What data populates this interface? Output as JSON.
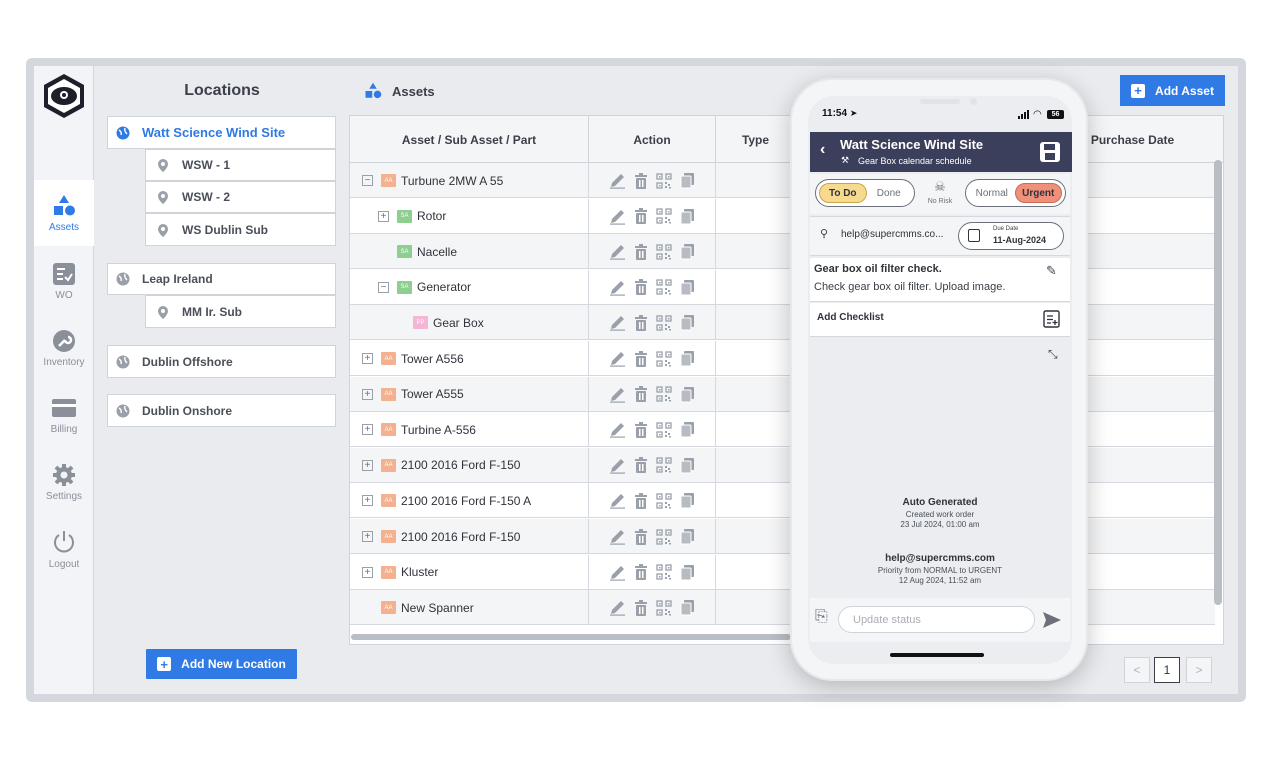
{
  "sidebar": {
    "items": [
      {
        "label": "Assets",
        "icon": "shapes-icon",
        "active": true
      },
      {
        "label": "WO",
        "icon": "checklist-icon"
      },
      {
        "label": "Inventory",
        "icon": "wrench-icon"
      },
      {
        "label": "Billing",
        "icon": "card-icon"
      },
      {
        "label": "Settings",
        "icon": "gear-icon"
      },
      {
        "label": "Logout",
        "icon": "power-icon"
      }
    ]
  },
  "locations": {
    "title": "Locations",
    "sites": [
      {
        "label": "Watt Science Wind Site",
        "selected": true,
        "subs": [
          "WSW - 1",
          "WSW - 2",
          "WS Dublin Sub"
        ]
      },
      {
        "label": "Leap Ireland",
        "subs": [
          "MM Ir. Sub"
        ]
      },
      {
        "label": "Dublin Offshore",
        "subs": []
      },
      {
        "label": "Dublin Onshore",
        "subs": []
      }
    ],
    "add_button": "Add New Location"
  },
  "assets": {
    "title": "Assets",
    "add_button": "Add Asset",
    "columns": [
      "Asset / Sub Asset / Part",
      "Action",
      "Type",
      "Purchase Date"
    ],
    "rows": [
      {
        "name": "Turbune 2MW A 55",
        "badge": "AA",
        "toggle": "−",
        "level": 0
      },
      {
        "name": "Rotor",
        "badge": "SA",
        "toggle": "+",
        "level": 1
      },
      {
        "name": "Nacelle",
        "badge": "SA",
        "toggle": "",
        "level": 1
      },
      {
        "name": "Generator",
        "badge": "SA",
        "toggle": "−",
        "level": 1
      },
      {
        "name": "Gear Box",
        "badge": "PP",
        "toggle": "",
        "level": 2
      },
      {
        "name": "Tower A556",
        "badge": "AA",
        "toggle": "+",
        "level": 0
      },
      {
        "name": "Tower A555",
        "badge": "AA",
        "toggle": "+",
        "level": 0
      },
      {
        "name": "Turbine A-556",
        "badge": "AA",
        "toggle": "+",
        "level": 0
      },
      {
        "name": "2100 2016 Ford F-150",
        "badge": "AA",
        "toggle": "+",
        "level": 0
      },
      {
        "name": "2100 2016 Ford F-150 A",
        "badge": "AA",
        "toggle": "+",
        "level": 0
      },
      {
        "name": "2100 2016 Ford F-150",
        "badge": "AA",
        "toggle": "+",
        "level": 0
      },
      {
        "name": "Kluster",
        "badge": "AA",
        "toggle": "+",
        "level": 0
      },
      {
        "name": "New Spanner",
        "badge": "AA",
        "toggle": "",
        "level": 0
      }
    ],
    "pagination": {
      "prev": "<",
      "current": "1",
      "next": ">"
    }
  },
  "phone": {
    "time": "11:54",
    "battery": "56",
    "header_title": "Watt Science Wind Site",
    "header_subtitle": "Gear Box calendar schedule",
    "status_todo": "To Do",
    "status_done": "Done",
    "risk_label": "No Risk",
    "priority_normal": "Normal",
    "priority_urgent": "Urgent",
    "assignee": "help@supercmms.co...",
    "due_label": "Due Date",
    "due_value": "11-Aug-2024",
    "task_title": "Gear box oil filter check.",
    "task_desc": "Check gear box oil filter. Upload image.",
    "add_checklist": "Add Checklist",
    "log": [
      {
        "title": "Auto Generated",
        "line1": "Created work order",
        "line2": "23 Jul 2024, 01:00 am"
      },
      {
        "title": "help@supercmms.com",
        "line1": "Priority from NORMAL to URGENT",
        "line2": "12 Aug 2024, 11:52 am"
      }
    ],
    "input_placeholder": "Update status"
  },
  "colors": {
    "accent": "#2f7ae5",
    "header": "#3c3f5c",
    "urgent": "#f0907a",
    "todo": "#f7d990"
  }
}
